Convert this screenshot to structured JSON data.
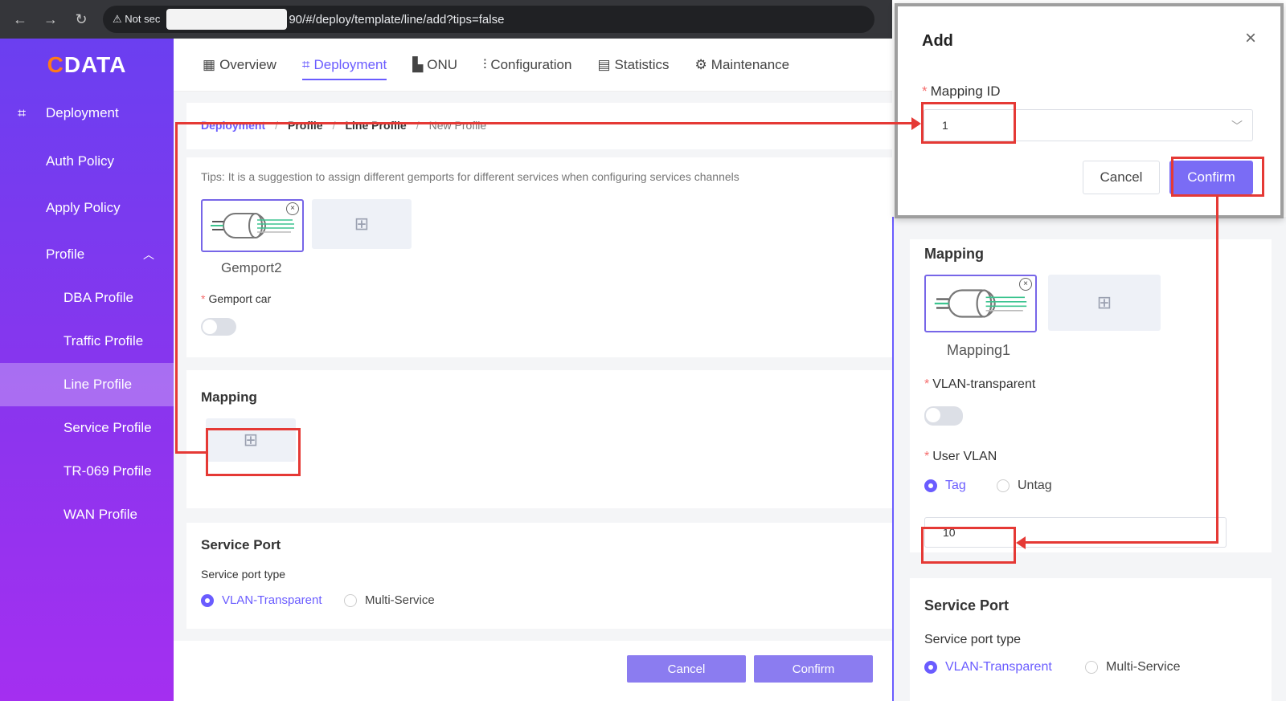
{
  "browser": {
    "back": "←",
    "forward": "→",
    "reload": "↻",
    "warning": "⚠ Not sec",
    "url_tail": "90/#/deploy/template/line/add?tips=false"
  },
  "logo": {
    "d": "C",
    "rest": "DATA"
  },
  "sidebar": {
    "deployment": "Deployment",
    "auth_policy": "Auth Policy",
    "apply_policy": "Apply Policy",
    "profile": "Profile",
    "dba_profile": "DBA Profile",
    "traffic_profile": "Traffic Profile",
    "line_profile": "Line Profile",
    "service_profile": "Service Profile",
    "tr069_profile": "TR-069 Profile",
    "wan_profile": "WAN Profile"
  },
  "topnav": {
    "overview": "Overview",
    "deployment": "Deployment",
    "onu": "ONU",
    "configuration": "Configuration",
    "statistics": "Statistics",
    "maintenance": "Maintenance"
  },
  "breadcrumb": {
    "c1": "Deployment",
    "c2": "Profile",
    "c3": "Line Profile",
    "c4": "New Profile",
    "sep": "/"
  },
  "main": {
    "tips": "Tips: It is a suggestion to assign different gemports for different services when configuring services channels",
    "gemport_name": "Gemport2",
    "gemport_car_label": "Gemport car",
    "mapping_title": "Mapping",
    "service_port_title": "Service Port",
    "service_port_type": "Service port type",
    "opt_vlan_transparent": "VLAN-Transparent",
    "opt_multi_service": "Multi-Service",
    "cancel": "Cancel",
    "confirm": "Confirm"
  },
  "right": {
    "mapping_title": "Mapping",
    "mapping_name": "Mapping1",
    "vlan_transparent_label": "VLAN-transparent",
    "user_vlan_label": "User VLAN",
    "opt_tag": "Tag",
    "opt_untag": "Untag",
    "vlan_value": "10",
    "service_port_title": "Service Port",
    "service_port_type": "Service port type",
    "opt_vlan_transparent": "VLAN-Transparent",
    "opt_multi_service": "Multi-Service"
  },
  "dialog": {
    "title": "Add",
    "close": "×",
    "mapping_id_label": "Mapping ID",
    "mapping_id_value": "1",
    "cancel": "Cancel",
    "confirm": "Confirm"
  },
  "colors": {
    "accent": "#6a5cff",
    "annotation": "#e53935",
    "sidebar_top": "#6b3ff0",
    "sidebar_bottom": "#a42ff0"
  }
}
